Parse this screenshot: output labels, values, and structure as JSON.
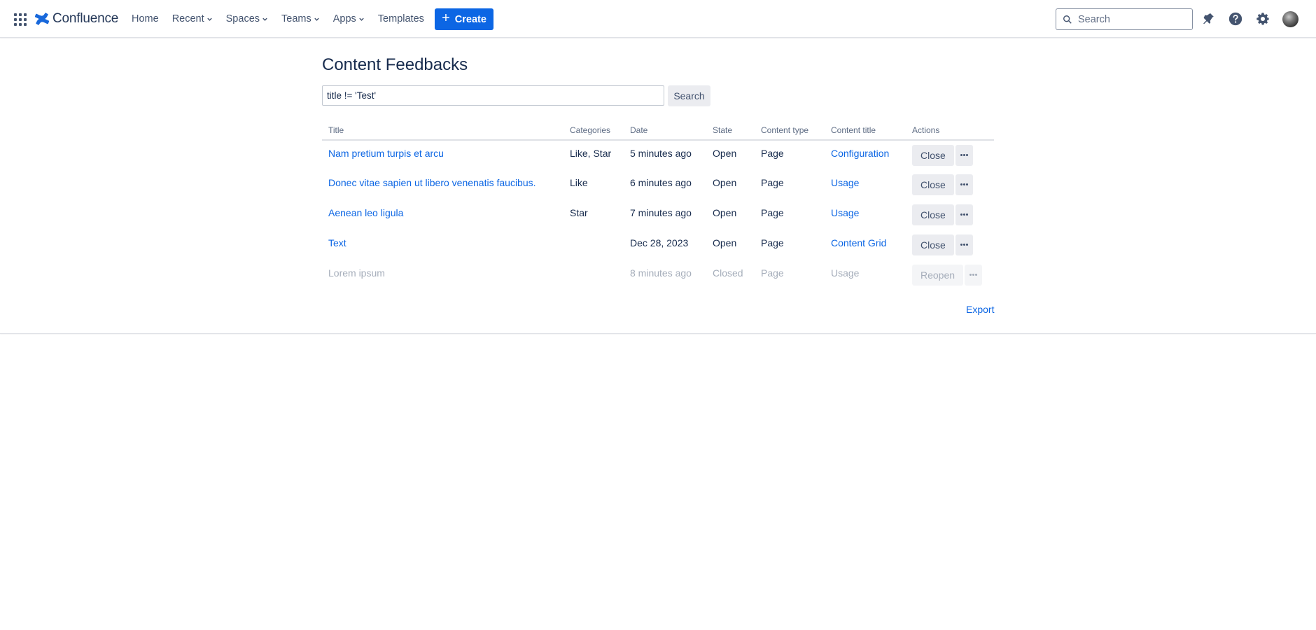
{
  "header": {
    "product_name": "Confluence",
    "nav": [
      {
        "label": "Home",
        "has_dropdown": false
      },
      {
        "label": "Recent",
        "has_dropdown": true
      },
      {
        "label": "Spaces",
        "has_dropdown": true
      },
      {
        "label": "Teams",
        "has_dropdown": true
      },
      {
        "label": "Apps",
        "has_dropdown": true
      },
      {
        "label": "Templates",
        "has_dropdown": false
      }
    ],
    "create_label": "Create",
    "search_placeholder": "Search",
    "icons": [
      "app-switcher-icon",
      "notifications-icon",
      "help-icon",
      "settings-icon",
      "avatar"
    ],
    "accent_color": "#0c66e4"
  },
  "main": {
    "title": "Content Feedbacks",
    "query_value": "title != 'Test'",
    "search_button_label": "Search",
    "table": {
      "columns": [
        "Title",
        "Categories",
        "Date",
        "State",
        "Content type",
        "Content title",
        "Actions"
      ],
      "rows": [
        {
          "title": "Nam pretium turpis et arcu",
          "categories": "Like, Star",
          "date": "5 minutes ago",
          "state": "Open",
          "content_type": "Page",
          "content_title": "Configuration",
          "action": "Close"
        },
        {
          "title": "Donec vitae sapien ut libero venenatis faucibus.",
          "categories": "Like",
          "date": "6 minutes ago",
          "state": "Open",
          "content_type": "Page",
          "content_title": "Usage",
          "action": "Close"
        },
        {
          "title": "Aenean leo ligula",
          "categories": "Star",
          "date": "7 minutes ago",
          "state": "Open",
          "content_type": "Page",
          "content_title": "Usage",
          "action": "Close"
        },
        {
          "title": "Text",
          "categories": "",
          "date": "Dec 28, 2023",
          "state": "Open",
          "content_type": "Page",
          "content_title": "Content Grid",
          "action": "Close"
        },
        {
          "title": "Lorem ipsum",
          "categories": "",
          "date": "8 minutes ago",
          "state": "Closed",
          "content_type": "Page",
          "content_title": "Usage",
          "action": "Reopen"
        }
      ]
    },
    "export_label": "Export"
  }
}
